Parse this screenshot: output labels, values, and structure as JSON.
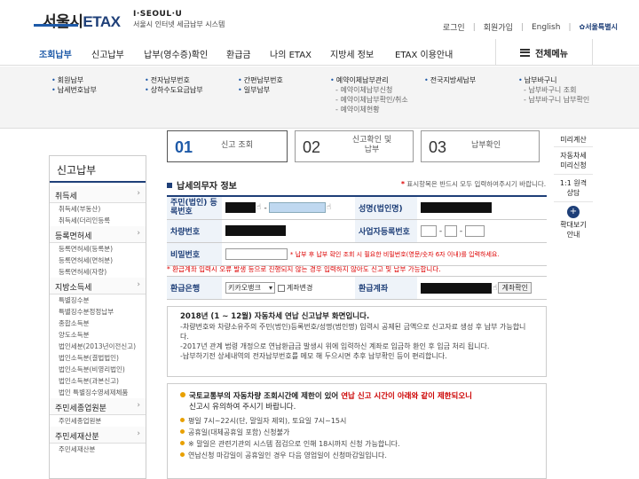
{
  "header": {
    "logo_city": "서울시",
    "logo_etax": "ETAX",
    "slogan": "I·SEOUL·U",
    "system_name": "서울시 인터넷 세금납부 시스템",
    "links": [
      "로그인",
      "회원가입",
      "English"
    ],
    "city_logo_text": "서울특별시"
  },
  "nav": {
    "items": [
      "조회납부",
      "신고납부",
      "납부(영수증)확인",
      "환급금",
      "나의 ETAX",
      "지방세 정보",
      "ETAX 이용안내"
    ],
    "all_menu": "전체메뉴"
  },
  "megamenu": {
    "col1": [
      "회원납부",
      "납세번호납부"
    ],
    "col2": [
      "전자납부번호",
      "상하수도요금납부"
    ],
    "col3": [
      "간편납부번호",
      "일부납부"
    ],
    "col4_head": "예약이체납부관리",
    "col4_sub": [
      "예약이체납부신청",
      "예약이체납부확인/취소",
      "예약이체현황"
    ],
    "col5": [
      "전국지방세납부"
    ],
    "col6_head": "납부바구니",
    "col6_sub": [
      "납부바구니 조회",
      "납부바구니 납부확인"
    ]
  },
  "steps": [
    {
      "num": "01",
      "label": "신고 조회"
    },
    {
      "num": "02",
      "label": "신고확인 및 납부"
    },
    {
      "num": "03",
      "label": "납부확인"
    }
  ],
  "sidebar": {
    "title": "신고납부",
    "sections": [
      {
        "head": "취득세",
        "items": [
          "취득세(부동산)",
          "취득세(더리인등록"
        ]
      },
      {
        "head": "등록면허세",
        "items": [
          "등록면허세(등록분)",
          "등록면허세(면허분)",
          "등록면허세(자량)"
        ]
      },
      {
        "head": "지방소득세",
        "items": [
          "특별징수분",
          "특별징수분정정납부",
          "종합소득분",
          "양도소득분",
          "법인세분(2013년이전신고)",
          "법인소득분(결법법인)",
          "법인소득분(비영리법인)",
          "법인소득분(과본신고)",
          "법인 특별징수영세제체품"
        ]
      },
      {
        "head": "주민세종업원분",
        "items": [
          "주민세종업원분"
        ]
      },
      {
        "head": "주민세재산분",
        "items": [
          "주민세재산분"
        ]
      }
    ]
  },
  "rightbar": {
    "items": [
      "미리계산",
      "자동차세 미리신청",
      "1:1 원격 상담"
    ],
    "zoom_label": "확대보기 안내",
    "zoom_symbol": "+"
  },
  "form": {
    "title": "납세의무자 정보",
    "required_note_mark": "*",
    "required_note": "표시항목은 반드시 모두 입력하여주시기 바랍니다.",
    "labels": {
      "rrn": "주민(법인) 등록번호",
      "name": "성명(법인명)",
      "vehicle": "차량번호",
      "bizno": "사업자등록번호",
      "password": "비밀번호",
      "bank": "환급은행",
      "account": "환급계좌"
    },
    "password_note": "* 납부 후 납부 확인 조회 시 필요한 비밀번호(영문/숫자 6자 이내)를 입력하세요.",
    "refund_note": "* 환급계좌 입력시 오류 발생 등으로 진행되지 않는 경우 입력하지 않아도 신고 및 납부 가능합니다.",
    "bank_value": "키카오뱅크",
    "account_change": "계좌변경",
    "account_check_btn": "계좌확인"
  },
  "notice1": {
    "title": "2018년 (1 ~ 12월) 자동차세 연납 신고납부 화면입니다.",
    "lines": [
      "-차량번호와 차량소유주의 주민(법인)등록번호/성명(법인명) 입력시 공제된 금액으로 신고자료 생성 후 납부 가능합니다.",
      "-2017년 관계 법령 개정으로 연납환급금 발생시 위에 입력하신 계좌로 입금하 환인 후 입금 처리 됩니다.",
      "-납부하기전 상세내역의 전자납부번호를 메모 해 두으시면 추후 납부확인 등이 편리합니다."
    ]
  },
  "notice2": {
    "title_pre": "국토교통부의 자동차량 조회시간에 제한이 있어",
    "title_red": "연납 신고 시간이 아래와 같이 제한되오니",
    "title_post": "신고시 유의하여 주시기 바랍니다.",
    "lines": [
      "평일 7시~22시(단, 말일자 제외), 토요일 7시~15시",
      "공휴일(대체공휴일 포함) 신청불가",
      "※ 말일은 관련기관의 시스템 점검으로 인해 18시까지 신청 가능합니다.",
      "연납신청 마감일이 공휴일인 경우 다음 영업일이 신청마감일입니다."
    ]
  }
}
